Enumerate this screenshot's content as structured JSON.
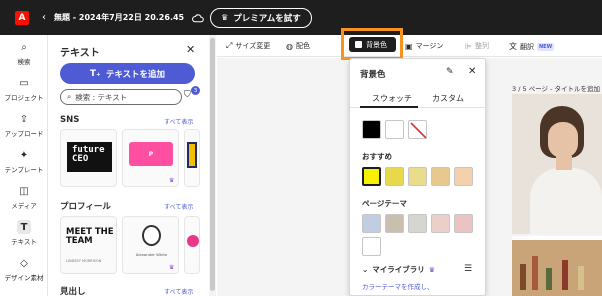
{
  "app": {
    "logo_letter": "A",
    "back_glyph": "‹",
    "document_title": "無題 - 2024年7月22日 20.26.45",
    "premium_label": "プレミアムを試す"
  },
  "rail": {
    "items": [
      {
        "label": "検索",
        "icon": "search-icon",
        "glyph": "⌕"
      },
      {
        "label": "プロジェクト",
        "icon": "folder-icon",
        "glyph": "▭"
      },
      {
        "label": "アップロード",
        "icon": "upload-icon",
        "glyph": "⇪"
      },
      {
        "label": "テンプレート",
        "icon": "template-icon",
        "glyph": "✦"
      },
      {
        "label": "メディア",
        "icon": "media-icon",
        "glyph": "◫"
      },
      {
        "label": "テキスト",
        "icon": "text-icon",
        "glyph": "T"
      },
      {
        "label": "デザイン素材",
        "icon": "design-assets-icon",
        "glyph": "◇"
      }
    ]
  },
  "panel": {
    "title": "テキスト",
    "add_text_label": "テキストを追加",
    "search_placeholder": "検索 : テキスト",
    "filter_badge": "3",
    "sections": [
      {
        "title": "SNS",
        "see_all": "すべて表示"
      },
      {
        "title": "プロフィール",
        "see_all": "すべて表示"
      },
      {
        "title": "見出し",
        "see_all": "すべて表示"
      }
    ],
    "sns_thumbs": {
      "future_text": "future CEO",
      "pink_text": "P"
    },
    "profile_thumbs": {
      "meet_text": "MEET THE TEAM",
      "meet_sub": "LINDSEY MORRISON",
      "person_name": "Alexander White"
    }
  },
  "toolbar": {
    "resize": "サイズ変更",
    "color_scheme": "配色",
    "background": "背景色",
    "margin": "マージン",
    "arrange": "整列",
    "translate": "翻訳",
    "new_badge": "NEW"
  },
  "canvas": {
    "page_info": "3 / 5 ページ - タイトルを追加"
  },
  "popover": {
    "title": "背景色",
    "tabs": [
      "スウォッチ",
      "カスタム"
    ],
    "recommended_label": "おすすめ",
    "page_theme_label": "ページテーマ",
    "library_label": "マイライブラリ",
    "library_link": "カラーテーマを作成し、",
    "base_swatches": [
      "#000000",
      "#ffffff",
      "none"
    ],
    "recommended_swatches": [
      "#f7f000",
      "#e7d84c",
      "#e9dc8c",
      "#e8c88e",
      "#f4d1ac"
    ],
    "page_theme_swatches": [
      "#c1cde0",
      "#c8bfae",
      "#d7d5cf",
      "#ead0c9",
      "#ebc3c3",
      "#ffffff"
    ]
  }
}
